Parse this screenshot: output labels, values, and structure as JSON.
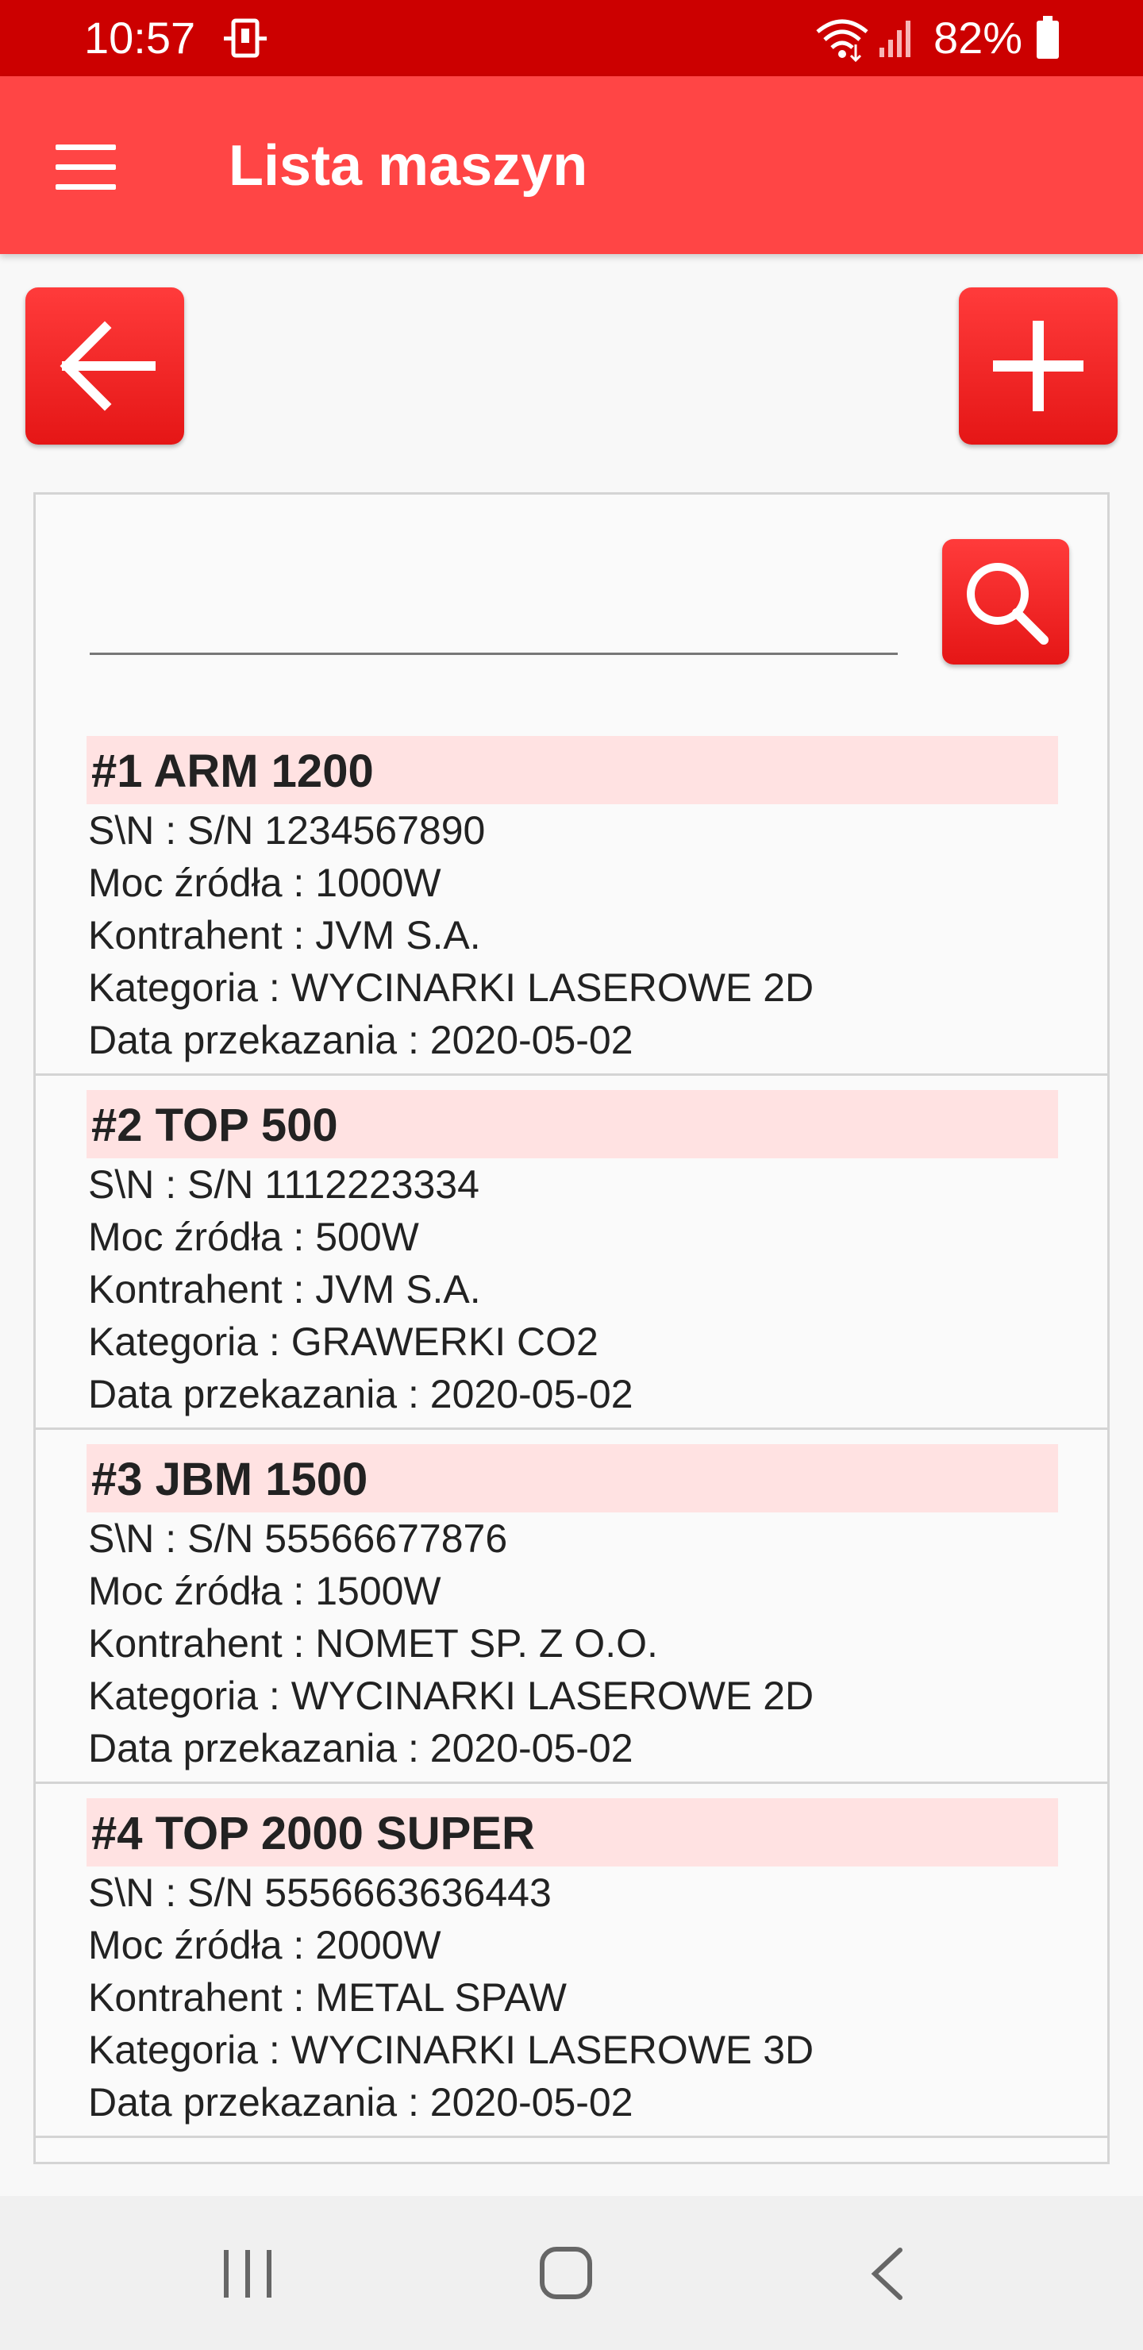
{
  "status_bar": {
    "time": "10:57",
    "battery": "82%",
    "icons": [
      "notification-icon",
      "wifi-icon",
      "signal-icon",
      "battery-icon"
    ]
  },
  "app_bar": {
    "title": "Lista maszyn",
    "menu_icon": "hamburger-menu-icon"
  },
  "toolbar": {
    "back_icon": "arrow-left-icon",
    "add_icon": "plus-icon"
  },
  "search": {
    "value": "",
    "placeholder": "",
    "icon": "search-icon"
  },
  "machines": [
    {
      "title": "#1 ARM 1200",
      "sn": "S\\N : S/N 1234567890",
      "power": "Moc źródła : 1000W",
      "contractor": "Kontrahent : JVM S.A.",
      "category": "Kategoria : WYCINARKI LASEROWE 2D",
      "date": "Data przekazania : 2020-05-02"
    },
    {
      "title": "#2 TOP 500",
      "sn": "S\\N : S/N 1112223334",
      "power": "Moc źródła : 500W",
      "contractor": "Kontrahent : JVM S.A.",
      "category": "Kategoria : GRAWERKI CO2",
      "date": "Data przekazania : 2020-05-02"
    },
    {
      "title": "#3 JBM 1500",
      "sn": "S\\N : S/N 55566677876",
      "power": "Moc źródła : 1500W",
      "contractor": "Kontrahent : NOMET SP. Z O.O.",
      "category": "Kategoria : WYCINARKI LASEROWE 2D",
      "date": "Data przekazania : 2020-05-02"
    },
    {
      "title": "#4 TOP 2000 SUPER",
      "sn": "S\\N : S/N 5556663636443",
      "power": "Moc źródła : 2000W",
      "contractor": "Kontrahent : METAL SPAW",
      "category": "Kategoria : WYCINARKI LASEROWE 3D",
      "date": "Data przekazania : 2020-05-02"
    }
  ],
  "nav_bar": {
    "icons": [
      "recents-icon",
      "home-icon",
      "back-icon"
    ]
  },
  "colors": {
    "status_bar": "#cc0000",
    "app_bar": "#ff4545",
    "button_red": "#e51616",
    "item_title_bg": "#ffe2e2"
  }
}
